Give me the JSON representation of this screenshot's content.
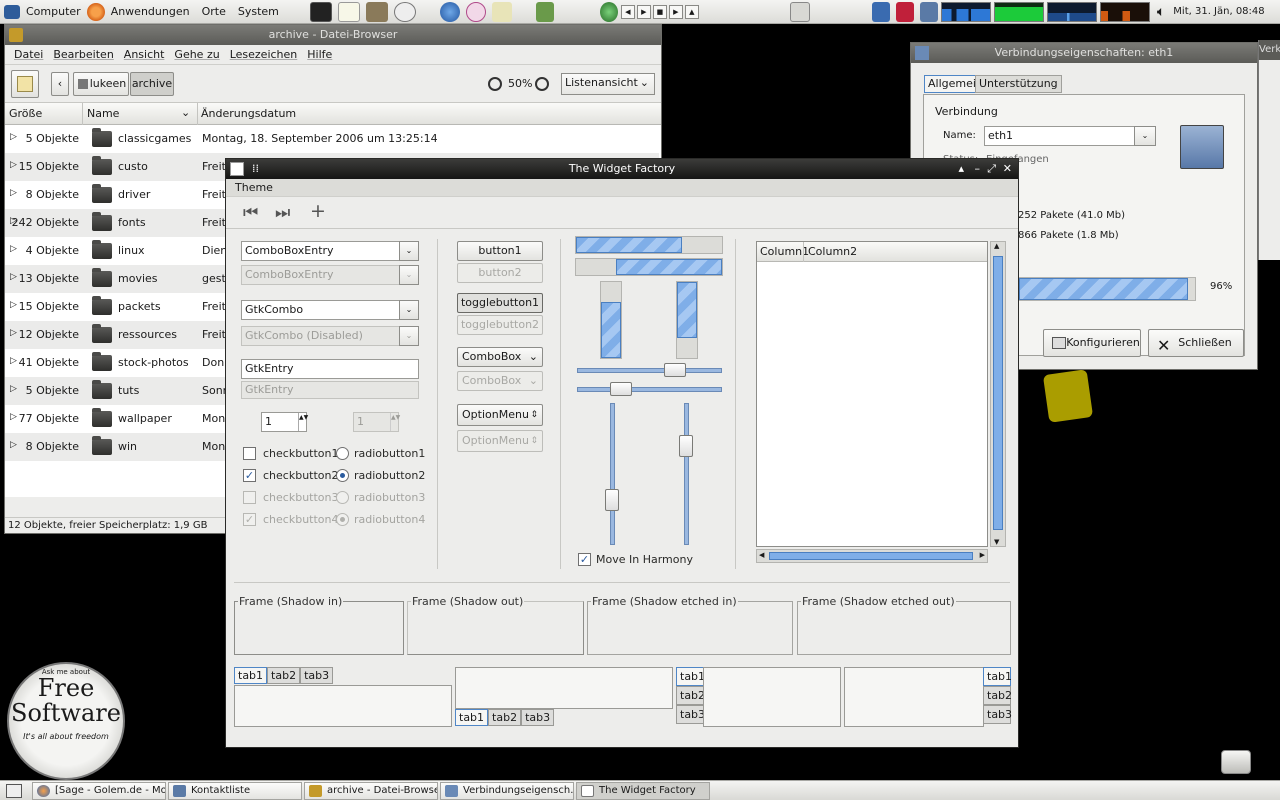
{
  "top_panel": {
    "menus": [
      "Computer",
      "Anwendungen",
      "Orte",
      "System"
    ],
    "clock": "Mit, 31. Jän, 08:48"
  },
  "file_browser": {
    "title": "archive - Datei-Browser",
    "menus": [
      "Datei",
      "Bearbeiten",
      "Ansicht",
      "Gehe zu",
      "Lesezeichen",
      "Hilfe"
    ],
    "path": [
      "lukeen",
      "archive"
    ],
    "zoom": "50%",
    "view_mode": "Listenansicht",
    "columns": [
      "Größe",
      "Name",
      "Änderungsdatum"
    ],
    "rows": [
      {
        "size": "5 Objekte",
        "name": "classicgames",
        "date": "Montag, 18. September 2006 um 13:25:14"
      },
      {
        "size": "15 Objekte",
        "name": "custo",
        "date": "Freita"
      },
      {
        "size": "8 Objekte",
        "name": "driver",
        "date": "Freita"
      },
      {
        "size": "242 Objekte",
        "name": "fonts",
        "date": "Freita"
      },
      {
        "size": "4 Objekte",
        "name": "linux",
        "date": "Diens"
      },
      {
        "size": "13 Objekte",
        "name": "movies",
        "date": "geste"
      },
      {
        "size": "15 Objekte",
        "name": "packets",
        "date": "Freita"
      },
      {
        "size": "12 Objekte",
        "name": "ressources",
        "date": "Freita"
      },
      {
        "size": "41 Objekte",
        "name": "stock-photos",
        "date": "Donn"
      },
      {
        "size": "5 Objekte",
        "name": "tuts",
        "date": "Sonn"
      },
      {
        "size": "77 Objekte",
        "name": "wallpaper",
        "date": "Mont"
      },
      {
        "size": "8 Objekte",
        "name": "win",
        "date": "Mont"
      }
    ],
    "status": "12 Objekte, freier Speicherplatz: 1,9 GB"
  },
  "connection": {
    "title": "Verbindungseigenschaften: eth1",
    "tabs": [
      "Allgemein",
      "Unterstützung"
    ],
    "section": "Verbindung",
    "name_label": "Name:",
    "name_value": "eth1",
    "status_label": "Status:",
    "status_value": "Eingefangen",
    "sent": "252 Pakete (41.0 Mb)",
    "received": "866 Pakete (1.8 Mb)",
    "signal_percent": "96%",
    "signal_value": 0.96,
    "configure_button": "Konfigurieren",
    "close_button": "Schließen",
    "behind_label": "Verk"
  },
  "widget_factory": {
    "title": "The Widget Factory",
    "menu": "Theme",
    "combo_entry": "ComboBoxEntry",
    "combo_entry_disabled": "ComboBoxEntry",
    "gtk_combo": "GtkCombo",
    "gtk_combo_disabled": "GtkCombo (Disabled)",
    "gtk_entry": "GtkEntry",
    "gtk_entry_disabled": "GtkEntry",
    "spin_value": "1",
    "spin_disabled_value": "1",
    "checks": [
      {
        "label": "checkbutton1",
        "checked": false,
        "disabled": false
      },
      {
        "label": "checkbutton2",
        "checked": true,
        "disabled": false
      },
      {
        "label": "checkbutton3",
        "checked": false,
        "disabled": true
      },
      {
        "label": "checkbutton4",
        "checked": true,
        "disabled": true
      }
    ],
    "radios": [
      {
        "label": "radiobutton1",
        "checked": false,
        "disabled": false
      },
      {
        "label": "radiobutton2",
        "checked": true,
        "disabled": false
      },
      {
        "label": "radiobutton3",
        "checked": false,
        "disabled": true
      },
      {
        "label": "radiobutton4",
        "checked": true,
        "disabled": true
      }
    ],
    "button1": "button1",
    "button2": "button2",
    "toggle1": "togglebutton1",
    "toggle2": "togglebutton2",
    "combobox": "ComboBox",
    "combobox_disabled": "ComboBox",
    "option_menu": "OptionMenu",
    "option_menu_disabled": "OptionMenu",
    "move_in_harmony": "Move In Harmony",
    "tree_columns": [
      "Column1",
      "Column2"
    ],
    "frames": [
      "Frame (Shadow in)",
      "Frame (Shadow out)",
      "Frame (Shadow etched in)",
      "Frame (Shadow etched out)"
    ],
    "tabs": [
      "tab1",
      "tab2",
      "tab3"
    ]
  },
  "desktop": {
    "badge_top": "Ask me about",
    "badge_line1": "Free",
    "badge_line2": "Software",
    "badge_bottom": "It's all about freedom"
  },
  "taskbar": {
    "items": [
      "[Sage - Golem.de - Mo...",
      "Kontaktliste",
      "archive - Datei-Browser",
      "Verbindungseigensch...",
      "The Widget Factory"
    ]
  }
}
